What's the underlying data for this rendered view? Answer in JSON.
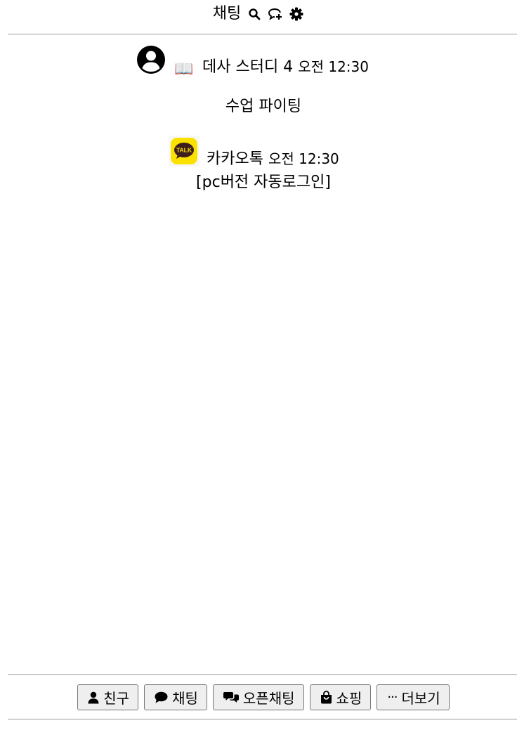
{
  "header": {
    "title": "채팅",
    "icons": [
      "search-icon",
      "chat-add-icon",
      "gear-icon"
    ]
  },
  "chats": [
    {
      "avatar": "user-circle-icon",
      "emoji": "📖",
      "name": "데사 스터디 4",
      "time": "오전 12:30",
      "message": "수업 파이팅"
    },
    {
      "avatar": "kakaotalk-logo",
      "logo_text": "TALK",
      "name": "카카오톡",
      "time": "오전 12:30",
      "message": "[pc버전 자동로그인]"
    }
  ],
  "nav": [
    {
      "label": "친구",
      "icon": "user-icon"
    },
    {
      "label": "채팅",
      "icon": "chat-bubble-icon"
    },
    {
      "label": "오픈채팅",
      "icon": "open-chat-icon"
    },
    {
      "label": "쇼핑",
      "icon": "shopping-bag-icon"
    },
    {
      "label": "더보기",
      "icon": "more-icon",
      "icon_glyph": "···"
    }
  ],
  "colors": {
    "divider": "#999999",
    "kakao_yellow": "#FAE100",
    "kakao_brown": "#3C1E1E"
  }
}
